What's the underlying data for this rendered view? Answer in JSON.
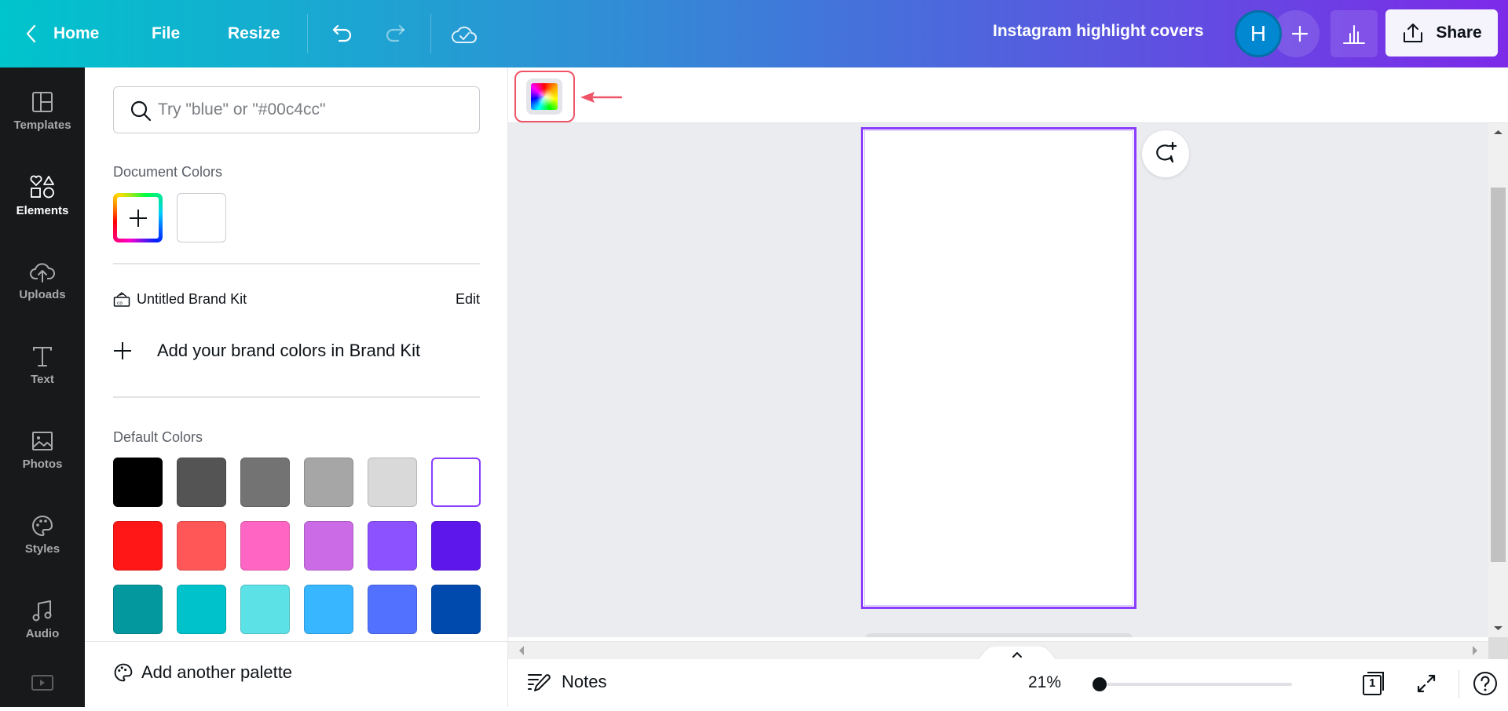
{
  "header": {
    "home_label": "Home",
    "file_label": "File",
    "resize_label": "Resize",
    "document_title": "Instagram highlight covers",
    "avatar_initial": "H",
    "share_label": "Share",
    "icons": [
      "chevron-left-icon",
      "undo-icon",
      "redo-icon",
      "cloud-saved-icon",
      "plus-icon",
      "analytics-icon",
      "share-upload-icon"
    ]
  },
  "sidebar": {
    "items": [
      {
        "label": "Templates",
        "icon": "templates-icon",
        "active": false
      },
      {
        "label": "Elements",
        "icon": "elements-icon",
        "active": true
      },
      {
        "label": "Uploads",
        "icon": "upload-cloud-icon",
        "active": false
      },
      {
        "label": "Text",
        "icon": "text-icon",
        "active": false
      },
      {
        "label": "Photos",
        "icon": "photos-icon",
        "active": false
      },
      {
        "label": "Styles",
        "icon": "palette-icon",
        "active": false
      },
      {
        "label": "Audio",
        "icon": "music-note-icon",
        "active": false
      },
      {
        "label": "",
        "icon": "video-icon",
        "active": false
      }
    ]
  },
  "color_panel": {
    "search_placeholder": "Try \"blue\" or \"#00c4cc\"",
    "search_value": "",
    "document_colors_label": "Document Colors",
    "document_colors": [
      "#ffffff"
    ],
    "brand_kit_name": "Untitled Brand Kit",
    "brand_kit_edit": "Edit",
    "add_brand_colors_label": "Add your brand colors in Brand Kit",
    "default_colors_label": "Default Colors",
    "default_colors": [
      [
        "#000000",
        "#545454",
        "#737373",
        "#a6a6a6",
        "#d9d9d9",
        "#ffffff"
      ],
      [
        "#ff1616",
        "#ff5757",
        "#ff66c4",
        "#cb6ce6",
        "#8c52ff",
        "#5e17eb"
      ],
      [
        "#03989e",
        "#00c2cb",
        "#5ce1e6",
        "#38b6ff",
        "#5271ff",
        "#004aad"
      ]
    ],
    "selected_default_color": "#ffffff",
    "add_palette_label": "Add another palette"
  },
  "toolbar": {
    "color_button": "rainbow-color-picker-icon",
    "annotation": "highlighted-with-red-box-and-arrow"
  },
  "canvas": {
    "page_background": "#ffffff",
    "selection_color": "#8b3dff"
  },
  "footer": {
    "notes_label": "Notes",
    "zoom_label": "21%",
    "zoom_fraction": 0.0,
    "page_count": "1"
  },
  "colors": {
    "accent": "#8b3dff",
    "annotation_red": "#ef5466",
    "sidebar_bg": "#18191b",
    "header_gradient_start": "#00c4cc",
    "header_gradient_end": "#7d2ae8"
  }
}
